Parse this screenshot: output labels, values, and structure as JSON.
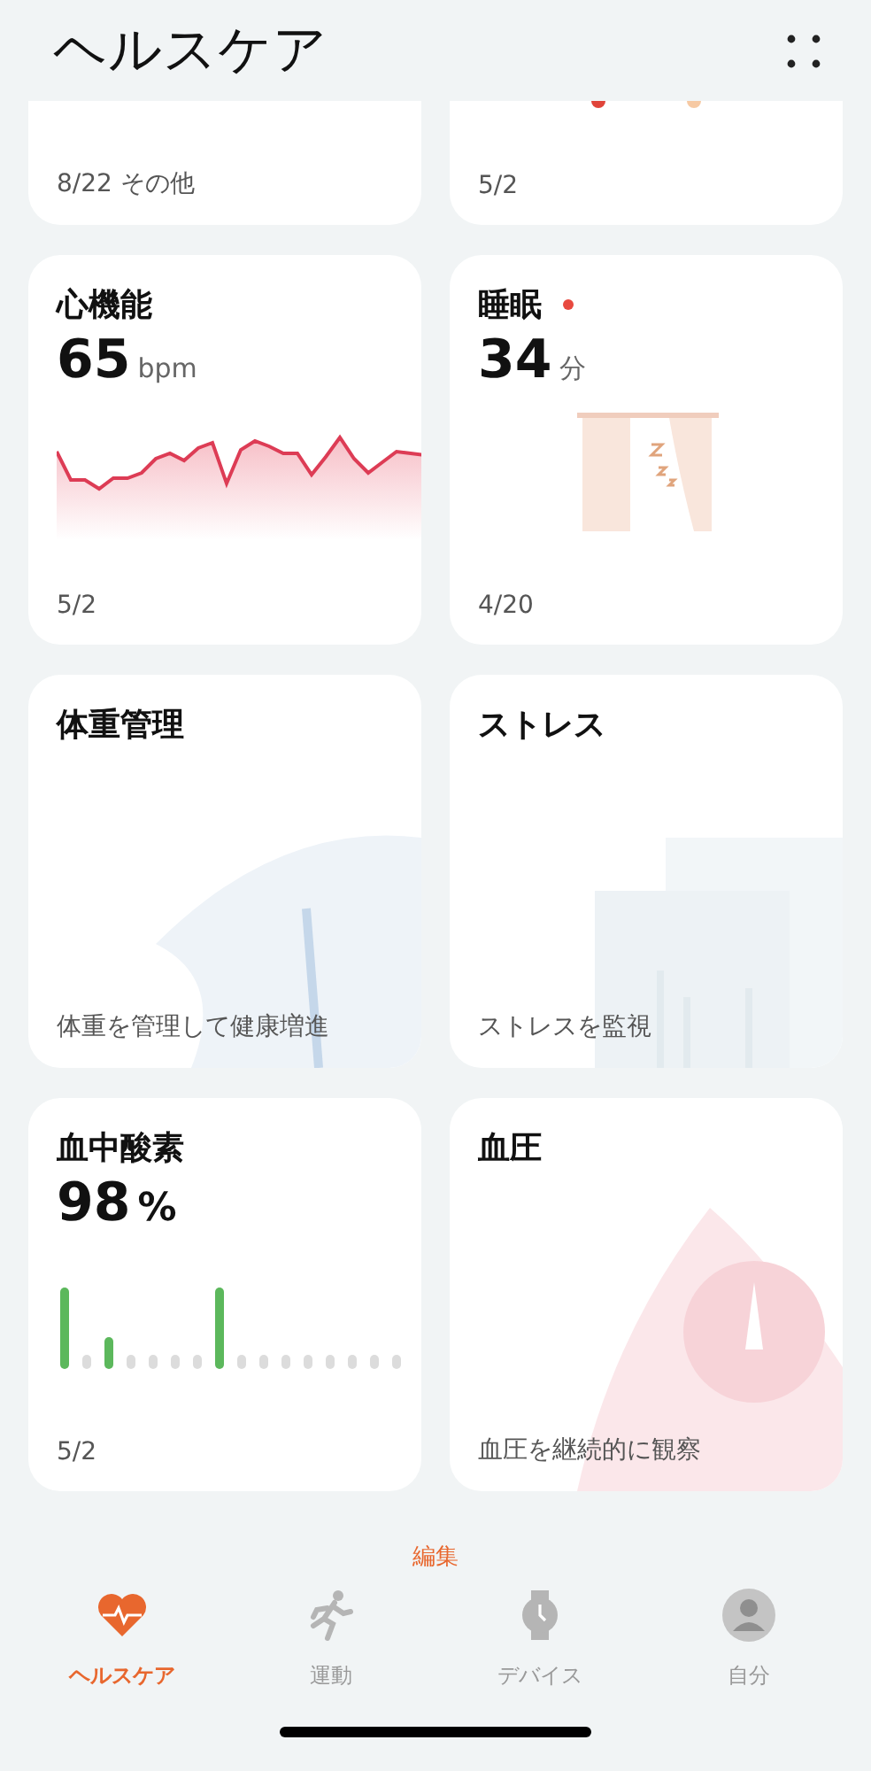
{
  "header": {
    "title": "ヘルスケア"
  },
  "cards": [
    {
      "kind": "partial",
      "footer": "8/22 その他"
    },
    {
      "kind": "partial_dots",
      "footer": "5/2"
    },
    {
      "kind": "line",
      "title": "心機能",
      "value": "65",
      "unit": "bpm",
      "footer": "5/2"
    },
    {
      "kind": "sleep",
      "title": "睡眠",
      "notification": true,
      "value": "34",
      "unit": "分",
      "footer": "4/20"
    },
    {
      "kind": "weight",
      "title": "体重管理",
      "footer": "体重を管理して健康増進"
    },
    {
      "kind": "stress",
      "title": "ストレス",
      "footer": "ストレスを監視"
    },
    {
      "kind": "bars",
      "title": "血中酸素",
      "value": "98",
      "unit": "%",
      "footer": "5/2"
    },
    {
      "kind": "pressure",
      "title": "血圧",
      "footer": "血圧を継続的に観察"
    }
  ],
  "edit_link": "編集",
  "tabs": [
    {
      "kind": "heart",
      "label": "ヘルスケア",
      "selected": true
    },
    {
      "kind": "run",
      "label": "運動",
      "selected": false
    },
    {
      "kind": "watch",
      "label": "デバイス",
      "selected": false
    },
    {
      "kind": "person",
      "label": "自分",
      "selected": false
    }
  ]
}
